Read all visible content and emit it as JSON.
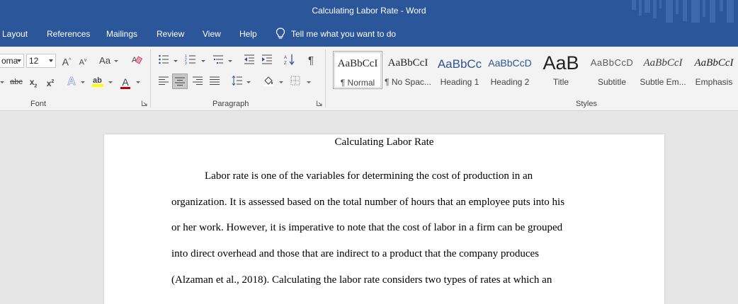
{
  "window": {
    "title": "Calculating Labor Rate  -  Word"
  },
  "menu": {
    "tabs": [
      "Layout",
      "References",
      "Mailings",
      "Review",
      "View",
      "Help"
    ],
    "tell_me": "Tell me what you want to do"
  },
  "ribbon": {
    "font": {
      "group_label": "Font",
      "font_name": "oma",
      "font_size": "12",
      "grow_label": "A",
      "shrink_label": "A",
      "change_case_label": "Aa",
      "strikethrough_label": "abc",
      "subscript_label": "x2",
      "superscript_label": "x2",
      "effects_label": "A",
      "font_color_label": "A",
      "font_color": "#c00000",
      "highlight_color": "#ffff00"
    },
    "paragraph": {
      "group_label": "Paragraph"
    },
    "styles": {
      "group_label": "Styles",
      "items": [
        {
          "sample": "AaBbCcI",
          "name": "¶ Normal"
        },
        {
          "sample": "AaBbCcI",
          "name": "¶ No Spac..."
        },
        {
          "sample": "AaBbCc",
          "name": "Heading 1"
        },
        {
          "sample": "AaBbCcD",
          "name": "Heading 2"
        },
        {
          "sample": "AaB",
          "name": "Title"
        },
        {
          "sample": "AaBbCcD",
          "name": "Subtitle"
        },
        {
          "sample": "AaBbCcI",
          "name": "Subtle Em..."
        },
        {
          "sample": "AaBbCcI",
          "name": "Emphasis"
        }
      ]
    }
  },
  "document": {
    "title": "Calculating Labor Rate",
    "lines": [
      "Labor rate is one of the variables for determining the cost of production in an",
      "organization. It is assessed based on the total number of hours that an employee puts into his",
      "or her work. However, it is imperative to note that the cost of labor in a firm can be grouped",
      "into direct overhead and those that are indirect to a product that the company produces",
      "(Alzaman et al., 2018). Calculating the labor rate considers two types of rates at which an"
    ]
  },
  "colors": {
    "brand": "#2b579a",
    "ribbon_bg": "#f3f3f3",
    "canvas_bg": "#e6e6e6"
  }
}
